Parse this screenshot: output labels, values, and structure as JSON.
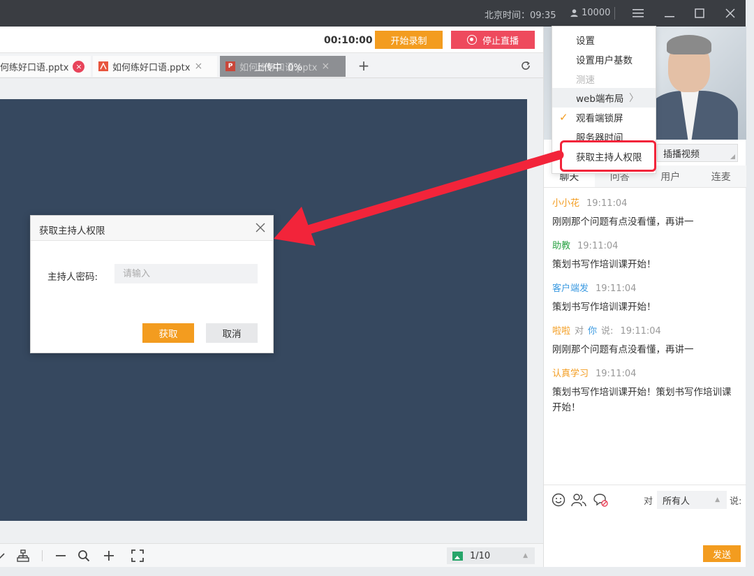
{
  "titlebar": {
    "beijing_time": "北京时间：09:35",
    "user_count": "10000",
    "icons": [
      "user-icon",
      "hamburger-menu-icon",
      "minimize-icon",
      "maximize-icon",
      "close-icon"
    ]
  },
  "toolbar": {
    "timer": "00:10:00",
    "record_label": "开始录制",
    "stop_live_label": "停止直播"
  },
  "tabs": [
    {
      "label": "何练好口语.pptx",
      "close": "×",
      "status": "active"
    },
    {
      "label": "如何练好口语.pptx",
      "close": "×",
      "icon": "pdf-icon"
    },
    {
      "label": "如何练好口语.pptx",
      "close": "×",
      "icon": "ppt-icon",
      "overlay": "上传中  0%"
    }
  ],
  "tab_actions": {
    "add": "+",
    "refresh_icon": "refresh-icon"
  },
  "slide": {
    "background": "#36485f"
  },
  "bottombar": {
    "page_indicator": "1/10",
    "icons": [
      "pen-icon",
      "tree-icon",
      "zoom-out-icon",
      "zoom-icon",
      "zoom-in-icon",
      "fullscreen-icon"
    ]
  },
  "menu": {
    "items": [
      {
        "label": "设置",
        "disabled": false
      },
      {
        "label": "设置用户基数",
        "disabled": false
      },
      {
        "label": "测速",
        "disabled": true
      },
      {
        "label": "web端布局",
        "disabled": false,
        "submenu": true
      },
      {
        "label": "观看端锁屏",
        "disabled": false,
        "checked": true
      },
      {
        "label": "服务器时间",
        "disabled": false
      },
      {
        "label": "获取主持人权限",
        "disabled": false,
        "highlighted": true
      }
    ]
  },
  "side": {
    "insert_video_label": "插播视频",
    "chat_tabs": [
      "聊天",
      "问答",
      "用户",
      "连麦"
    ],
    "messages": [
      {
        "name": "小小花",
        "name_color": "orange",
        "time": "19:11:04",
        "text": "刚刚那个问题有点没看懂，再讲一"
      },
      {
        "name": "助教",
        "name_color": "green",
        "time": "19:11:04",
        "text": "策划书写作培训课开始！"
      },
      {
        "name": "客户端发",
        "name_color": "blue",
        "time": "19:11:04",
        "text": "策划书写作培训课开始！"
      },
      {
        "name": "啦啦",
        "name_color": "orange",
        "to_word": "对",
        "target": "你",
        "say": "说:",
        "time": "19:11:04",
        "text": "刚刚那个问题有点没看懂，再讲一"
      },
      {
        "name": "认真学习",
        "name_color": "orange",
        "time": "19:11:04",
        "text": "策划书写作培训课开始！策划书写作培训课开始！"
      }
    ],
    "input": {
      "to_label": "对",
      "target_value": "所有人",
      "say_label": "说:",
      "send_label": "发送",
      "icons": [
        "emoji-icon",
        "users-icon",
        "no-chat-icon"
      ]
    }
  },
  "dialog": {
    "title": "获取主持人权限",
    "password_label": "主持人密码:",
    "password_placeholder": "请输入",
    "ok_label": "获取",
    "cancel_label": "取消"
  },
  "colors": {
    "accent_orange": "#f39c1f",
    "stop_red": "#ee4a5d",
    "highlight_red": "#f2243a",
    "titlebar": "#3a3d42"
  }
}
